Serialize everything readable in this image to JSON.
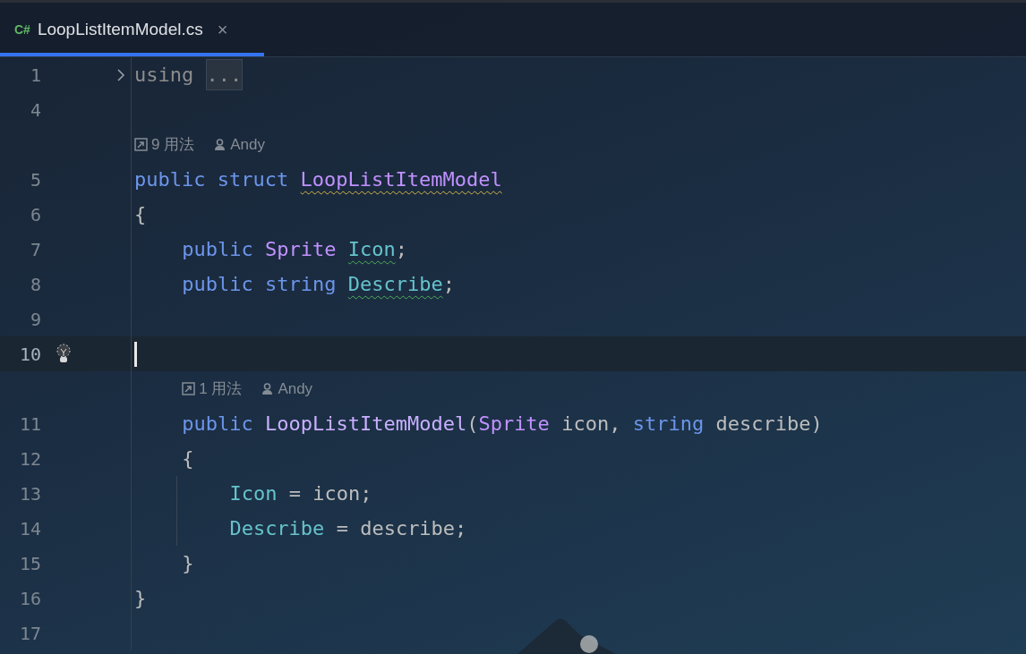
{
  "tab": {
    "lang_badge": "C#",
    "title": "LoopListItemModel.cs",
    "selected": true,
    "close": "×"
  },
  "lines": [
    {
      "kind": "code",
      "number": "1",
      "folded": true,
      "tokens": [
        {
          "kind": "muted",
          "text": "using"
        },
        {
          "kind": "fold",
          "text": "..."
        }
      ]
    },
    {
      "kind": "code",
      "number": "4"
    },
    {
      "kind": "hint",
      "usages": "9 用法",
      "author": "Andy"
    },
    {
      "kind": "code",
      "number": "5",
      "tokens": [
        {
          "kind": "keyword",
          "text": "public"
        },
        {
          "kind": "keyword",
          "text": "struct"
        },
        {
          "kind": "type",
          "text": "LoopListItemModel",
          "warning": true
        }
      ]
    },
    {
      "kind": "code",
      "number": "6",
      "tokens": [
        {
          "kind": "plain",
          "text": "{"
        }
      ],
      "children": [
        {
          "kind": "code",
          "number": "7",
          "tokens": [
            {
              "kind": "keyword",
              "text": "public"
            },
            {
              "kind": "type",
              "text": "Sprite"
            },
            {
              "kind": "field",
              "text": "Icon",
              "typo": true
            },
            {
              "kind": "plain",
              "text": ";",
              "glue": true
            }
          ]
        },
        {
          "kind": "code",
          "number": "8",
          "tokens": [
            {
              "kind": "keyword",
              "text": "public"
            },
            {
              "kind": "keyword",
              "text": "string"
            },
            {
              "kind": "field",
              "text": "Describe",
              "typo": true
            },
            {
              "kind": "plain",
              "text": ";",
              "glue": true
            }
          ]
        },
        {
          "kind": "code",
          "number": "9"
        },
        {
          "kind": "code",
          "number": "10",
          "current": true,
          "bulb": true
        },
        {
          "kind": "hint",
          "usages": "1 用法",
          "author": "Andy"
        },
        {
          "kind": "code",
          "number": "11",
          "tokens": [
            {
              "kind": "keyword",
              "text": "public"
            },
            {
              "kind": "method",
              "text": "LoopListItemModel"
            },
            {
              "kind": "plain",
              "text": "(",
              "glue": true
            },
            {
              "kind": "type",
              "text": "Sprite",
              "glue": true
            },
            {
              "kind": "plain",
              "text": "icon,"
            },
            {
              "kind": "keyword",
              "text": "string"
            },
            {
              "kind": "plain",
              "text": "describe)"
            }
          ]
        },
        {
          "kind": "code",
          "number": "12",
          "tokens": [
            {
              "kind": "plain",
              "text": "{"
            }
          ],
          "children": [
            {
              "kind": "code",
              "number": "13",
              "tokens": [
                {
                  "kind": "field",
                  "text": "Icon"
                },
                {
                  "kind": "plain",
                  "text": "= icon;"
                }
              ]
            },
            {
              "kind": "code",
              "number": "14",
              "tokens": [
                {
                  "kind": "field",
                  "text": "Describe"
                },
                {
                  "kind": "plain",
                  "text": "= describe;"
                }
              ]
            }
          ]
        },
        {
          "kind": "code",
          "number": "15",
          "tokens": [
            {
              "kind": "plain",
              "text": "}"
            }
          ]
        }
      ]
    },
    {
      "kind": "code",
      "number": "16",
      "tokens": [
        {
          "kind": "plain",
          "text": "}"
        }
      ]
    },
    {
      "kind": "code",
      "number": "17"
    }
  ]
}
